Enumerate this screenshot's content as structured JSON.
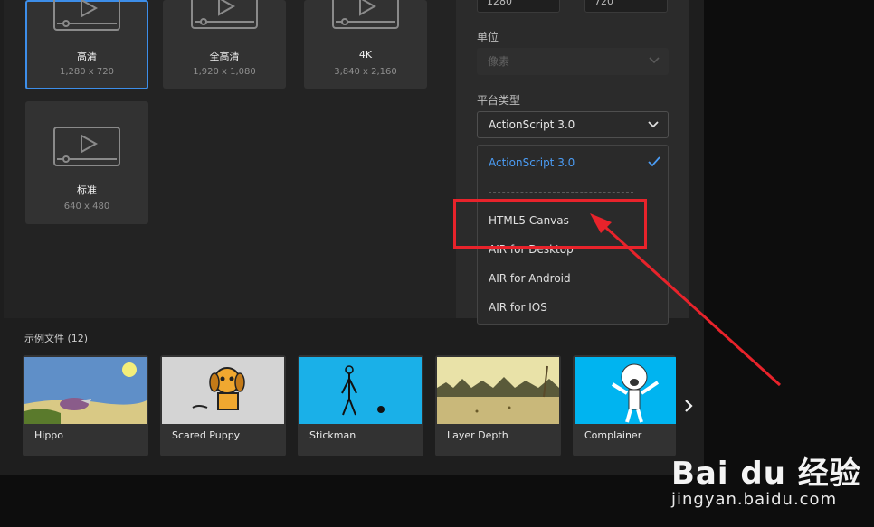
{
  "presets": [
    {
      "name": "高清",
      "dim": "1,280 x 720",
      "selected": true
    },
    {
      "name": "全高清",
      "dim": "1,920 x 1,080",
      "selected": false
    },
    {
      "name": "4K",
      "dim": "3,840 x 2,160",
      "selected": false
    },
    {
      "name": "标准",
      "dim": "640 x 480",
      "selected": false
    }
  ],
  "settings": {
    "width_value": "1280",
    "height_value": "720",
    "unit_label": "单位",
    "unit_value": "像素",
    "platform_label": "平台类型",
    "platform_value": "ActionScript 3.0"
  },
  "dropdown": {
    "items": [
      "ActionScript 3.0",
      "HTML5 Canvas",
      "AIR for Desktop",
      "AIR for Android",
      "AIR for IOS"
    ],
    "checked_index": 0
  },
  "samples": {
    "title": "示例文件 (12)",
    "items": [
      "Hippo",
      "Scared Puppy",
      "Stickman",
      "Layer Depth",
      "Complainer"
    ]
  },
  "colors": {
    "accent": "#3d8ee9",
    "annotation": "#e8232b"
  },
  "watermark": {
    "brand": "Bai du 经验",
    "url": "jingyan.baidu.com"
  }
}
